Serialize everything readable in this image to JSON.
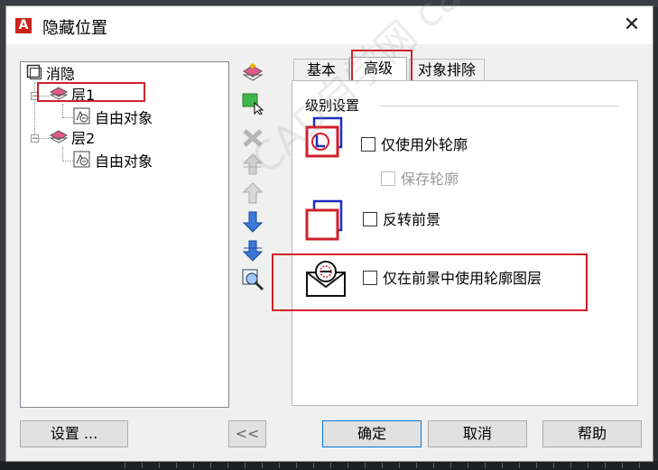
{
  "window": {
    "title": "隐藏位置",
    "close_glyph": "✕",
    "app_icon_letter": "A"
  },
  "tree": {
    "root": "消隐",
    "layers": [
      {
        "label": "层1",
        "child": "自由对象"
      },
      {
        "label": "层2",
        "child": "自由对象"
      }
    ]
  },
  "tabs": [
    {
      "label": "基本",
      "active": false
    },
    {
      "label": "高级",
      "active": true
    },
    {
      "label": "对象排除",
      "active": false
    }
  ],
  "advanced": {
    "group_title": "级别设置",
    "options": {
      "outer_contour": {
        "label": "仅使用外轮廓",
        "checked": false,
        "enabled": true
      },
      "keep_contour": {
        "label": "保存轮廓",
        "checked": false,
        "enabled": false
      },
      "reverse_foreground": {
        "label": "反转前景",
        "checked": false,
        "enabled": true
      },
      "contour_layer": {
        "label": "仅在前景中使用轮廓图层",
        "checked": false,
        "enabled": true
      }
    }
  },
  "buttons": {
    "settings": "设置 ...",
    "collapse": "<<",
    "ok": "确定",
    "cancel": "取消",
    "help": "帮助"
  },
  "watermark": "CAD自学网 cadzxw.com",
  "colors": {
    "highlight_red": "#d0202a",
    "icon_blue": "#1a2fc0",
    "icon_red": "#d0202a"
  }
}
